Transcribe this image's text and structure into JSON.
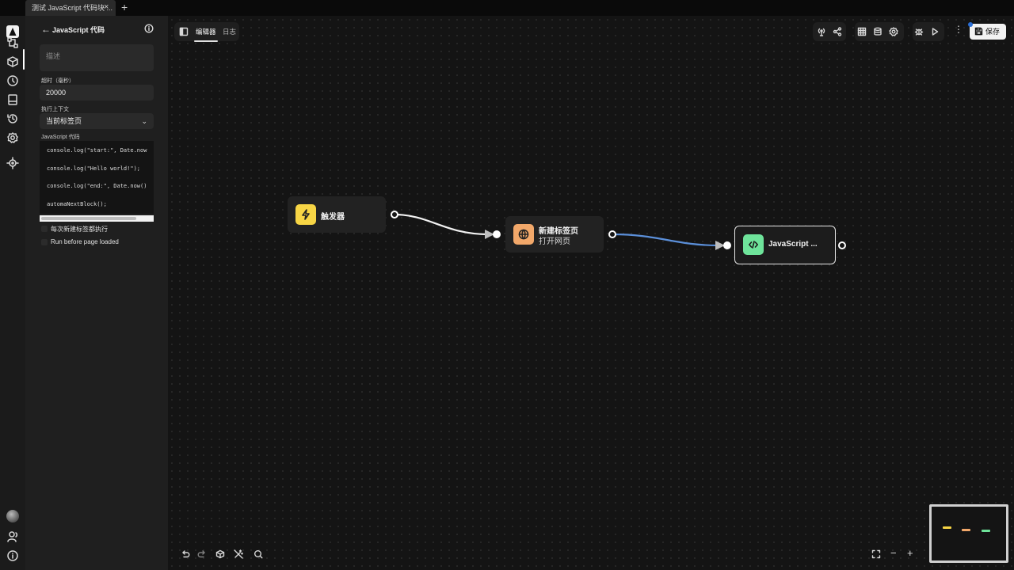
{
  "browser": {
    "tab_title": "测试 JavaScript 代码块 ...",
    "close_glyph": "×",
    "new_tab_glyph": "+"
  },
  "panel": {
    "back_glyph": "←",
    "title": "JavaScript 代码",
    "description_placeholder": "描述",
    "timeout_label": "超时（毫秒）",
    "timeout_value": "20000",
    "context_label": "执行上下文",
    "context_value": "当前标签页",
    "code_label": "JavaScript 代码",
    "code_lines": [
      "console.log(\"start:\", Date.now",
      "console.log(\"Hello world!\");",
      "console.log(\"end:\", Date.now()",
      "automaNextBlock();"
    ],
    "checkbox_every_new_tab": "每次新建标签都执行",
    "checkbox_before_load": "Run before page loaded"
  },
  "editor": {
    "tab_editor": "编辑器",
    "tab_log": "日志",
    "save_label": "保存",
    "more_glyph": "⋮"
  },
  "nodes": {
    "trigger": {
      "title": "触发器",
      "icon": "lightning-icon",
      "color": "#f7d545"
    },
    "new_tab": {
      "title": "新建标签页",
      "subtitle": "打开网页",
      "icon": "globe-icon",
      "color": "#f2a86a"
    },
    "javascript": {
      "title": "JavaScript ...",
      "icon": "code-icon",
      "color": "#6ee39a"
    }
  },
  "edges": {
    "active_color": "#5b8fd9",
    "default_color": "#f2f2f2"
  },
  "zoom": {
    "minus": "−",
    "plus": "+"
  }
}
